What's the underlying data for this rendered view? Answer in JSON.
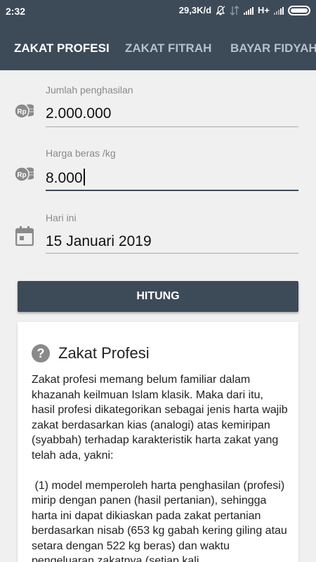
{
  "status": {
    "time": "2:32",
    "speed": "29,3K/d",
    "network": "H+"
  },
  "tabs": [
    {
      "label": "ZAKAT PROFESI",
      "active": true
    },
    {
      "label": "ZAKAT FITRAH",
      "active": false
    },
    {
      "label": "BAYAR FIDYAH",
      "active": false
    }
  ],
  "form": {
    "income": {
      "label": "Jumlah penghasilan",
      "value": "2.000.000",
      "icon": "rp-coins-icon"
    },
    "rice": {
      "label": "Harga beras /kg",
      "value": "8.000",
      "icon": "rp-coins-icon"
    },
    "date": {
      "label": "Hari ini",
      "value": "15 Januari 2019",
      "icon": "calendar-icon"
    }
  },
  "button": {
    "label": "HITUNG"
  },
  "info": {
    "title": "Zakat Profesi",
    "body": "Zakat profesi memang belum familiar dalam khazanah keilmuan Islam klasik. Maka dari itu, hasil profesi dikategorikan sebagai jenis harta wajib zakat berdasarkan kias (analogi) atas kemiripan (syabbah) terhadap karakteristik harta zakat yang telah ada, yakni:\n\n (1) model memperoleh harta penghasilan (profesi) mirip dengan panen (hasil pertanian), sehingga harta ini dapat dikiaskan pada zakat pertanian berdasarkan nisab (653 kg gabah kering giling atau setara dengan 522 kg beras) dan waktu pengeluaran zakatnya (setiap kali"
  },
  "colors": {
    "primary": "#3d4a58",
    "background": "#f0f0f0"
  }
}
